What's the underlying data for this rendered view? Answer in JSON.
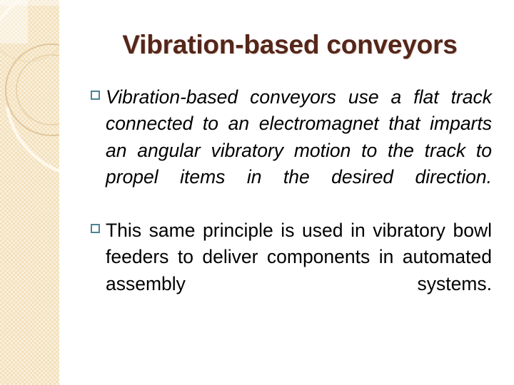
{
  "slide": {
    "title": "Vibration-based conveyors",
    "title_color": "#55261a",
    "background_color": "#ffffff",
    "sidebar_color": "#f3e0bb",
    "bullet_marker_color": "#4c8395",
    "bullet_marker_glyph": "□",
    "body_text_color": "#000000"
  },
  "bullets": [
    {
      "id": "bullet-1",
      "style": "italic",
      "text": "Vibration-based conveyors use a flat track connected to an electromagnet that imparts an angular vibratory motion to the track to propel items in the desired direction."
    },
    {
      "id": "bullet-2",
      "style": "normal",
      "text": "This same principle is used in vibratory bowl feeders to deliver components in automated assembly systems."
    }
  ]
}
